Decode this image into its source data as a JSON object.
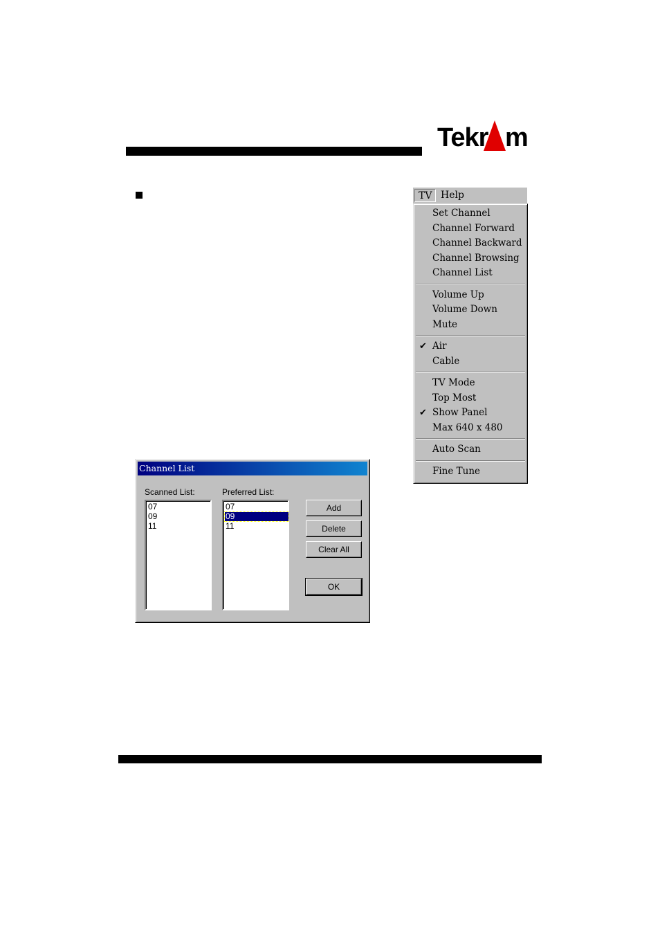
{
  "logo": {
    "text_left": "Tekr",
    "text_right": "m"
  },
  "menubar": {
    "items": [
      "TV",
      "Help"
    ]
  },
  "menu": {
    "groups": [
      [
        {
          "label": "Set Channel",
          "checked": false
        },
        {
          "label": "Channel Forward",
          "checked": false
        },
        {
          "label": "Channel Backward",
          "checked": false
        },
        {
          "label": "Channel Browsing",
          "checked": false
        },
        {
          "label": "Channel List",
          "checked": false
        }
      ],
      [
        {
          "label": "Volume Up",
          "checked": false
        },
        {
          "label": "Volume Down",
          "checked": false
        },
        {
          "label": "Mute",
          "checked": false
        }
      ],
      [
        {
          "label": "Air",
          "checked": true
        },
        {
          "label": "Cable",
          "checked": false
        }
      ],
      [
        {
          "label": "TV Mode",
          "checked": false
        },
        {
          "label": "Top Most",
          "checked": false
        },
        {
          "label": "Show Panel",
          "checked": true
        },
        {
          "label": "Max 640 x 480",
          "checked": false
        }
      ],
      [
        {
          "label": "Auto Scan",
          "checked": false
        }
      ],
      [
        {
          "label": "Fine Tune",
          "checked": false
        }
      ]
    ]
  },
  "dialog": {
    "title": "Channel List",
    "scanned_label": "Scanned List:",
    "preferred_label": "Preferred List:",
    "scanned_items": [
      "07",
      "09",
      "11"
    ],
    "preferred_items": [
      "07",
      "09",
      "11"
    ],
    "preferred_selected": "09",
    "buttons": {
      "add": "Add",
      "delete": "Delete",
      "clear_all": "Clear All",
      "ok": "OK"
    }
  }
}
